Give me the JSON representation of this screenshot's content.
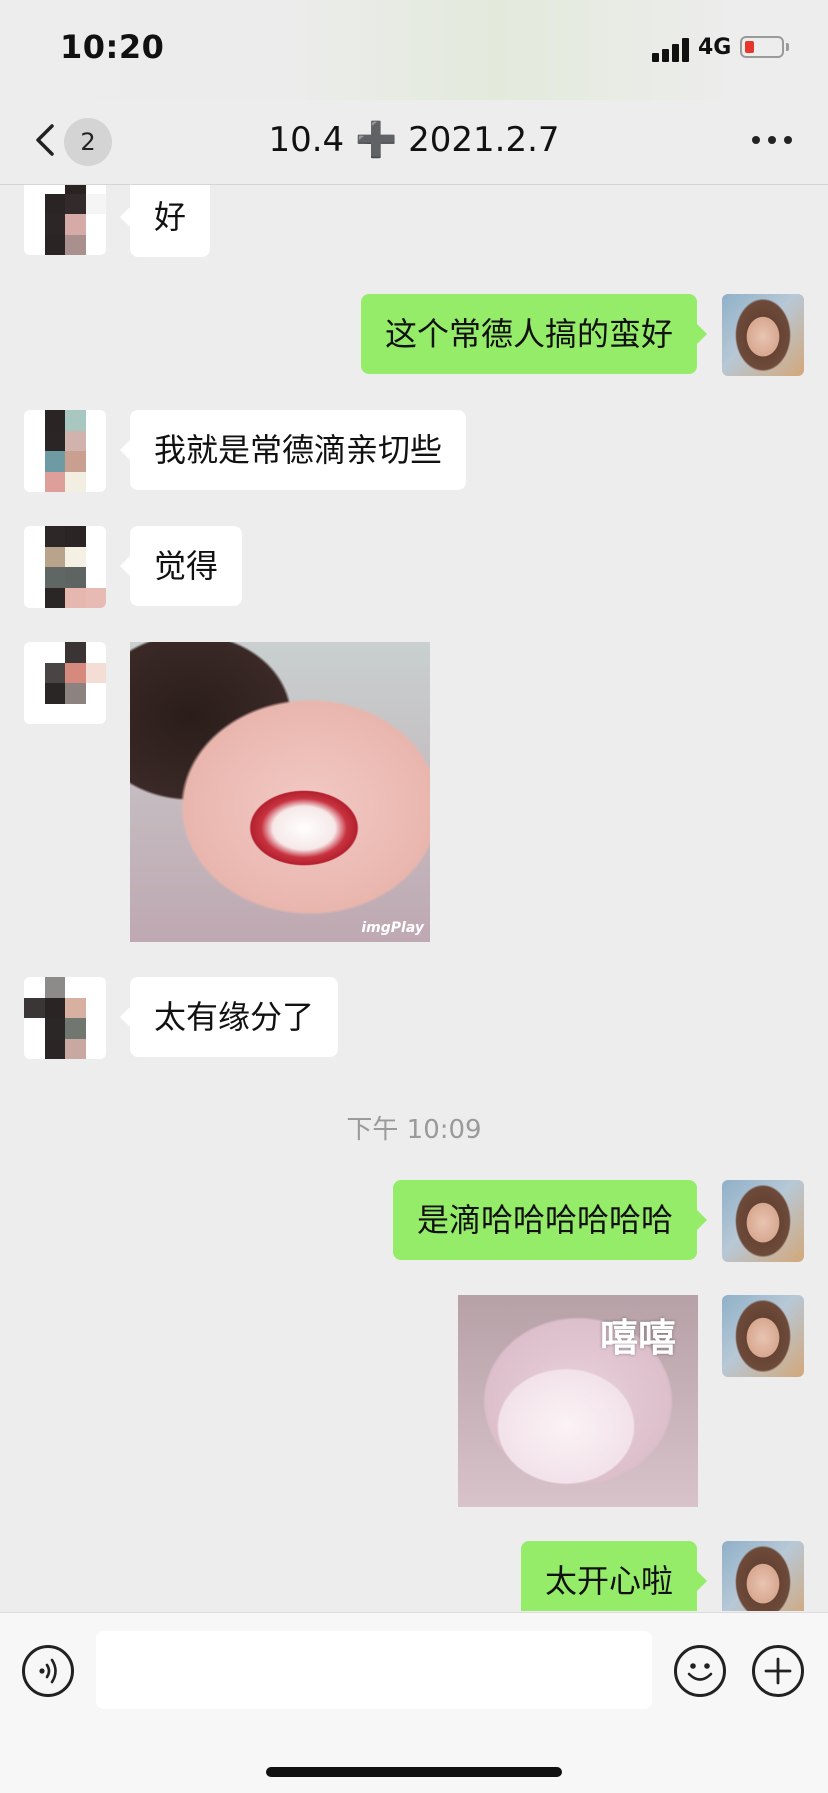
{
  "status_bar": {
    "time": "10:20",
    "network": "4G"
  },
  "nav": {
    "unread_count": "2",
    "title": "10.4 ➕ 2021.2.7"
  },
  "messages": [
    {
      "side": "in",
      "text": "好"
    },
    {
      "side": "out",
      "text": "这个常德人搞的蛮好"
    },
    {
      "side": "in",
      "text": "我就是常德滴亲切些"
    },
    {
      "side": "in",
      "text": "觉得"
    },
    {
      "side": "in",
      "type": "sticker",
      "watermark": "imgPlay"
    },
    {
      "side": "in",
      "text": "太有缘分了"
    },
    {
      "side": "out",
      "text": "是滴哈哈哈哈哈哈"
    },
    {
      "side": "out",
      "type": "sticker",
      "caption": "嘻嘻"
    },
    {
      "side": "out",
      "text": "太开心啦"
    }
  ],
  "timestamp": "下午 10:09",
  "colors": {
    "outgoing_bubble": "#95ec69",
    "incoming_bubble": "#ffffff",
    "background": "#ededed"
  }
}
